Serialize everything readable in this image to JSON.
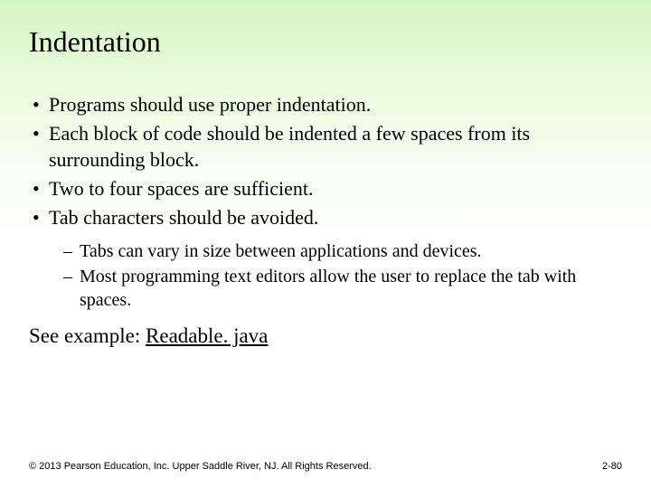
{
  "title": "Indentation",
  "bullets": [
    "Programs should use proper indentation.",
    "Each block of code should be indented a few spaces from its surrounding block.",
    "Two to four spaces are sufficient.",
    "Tab characters should be avoided."
  ],
  "sub_bullets": [
    "Tabs can vary in size between applications and devices.",
    "Most programming text editors allow the user to replace the tab with spaces."
  ],
  "see_example_label": "See example: ",
  "see_example_link": "Readable. java",
  "footer": {
    "copyright": "© 2013 Pearson Education, Inc. Upper Saddle River, NJ. All Rights Reserved.",
    "page": "2-80"
  }
}
